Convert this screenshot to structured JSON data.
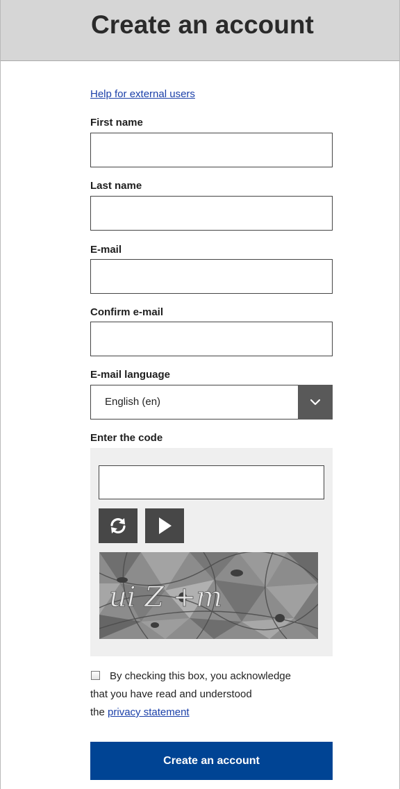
{
  "header": {
    "title": "Create an account"
  },
  "help_link": "Help for external users",
  "fields": {
    "first_name": {
      "label": "First name",
      "value": ""
    },
    "last_name": {
      "label": "Last name",
      "value": ""
    },
    "email": {
      "label": "E-mail",
      "value": ""
    },
    "confirm_email": {
      "label": "Confirm e-mail",
      "value": ""
    }
  },
  "language": {
    "label": "E-mail language",
    "selected": "English (en)"
  },
  "captcha": {
    "label": "Enter the code",
    "value": "",
    "code_text": "ui Z +m"
  },
  "consent": {
    "line1": "By checking this box, you acknowledge",
    "line2": "that you have read and understood",
    "prefix": "the",
    "link": "privacy statement"
  },
  "submit_label": "Create an account",
  "colors": {
    "header_bg": "#d6d6d6",
    "primary": "#004494",
    "link": "#1a3fa8",
    "dropdown_button": "#595959",
    "icon_button": "#474747"
  },
  "icons": {
    "dropdown": "chevron-down-icon",
    "refresh": "refresh-icon",
    "audio": "play-icon"
  }
}
